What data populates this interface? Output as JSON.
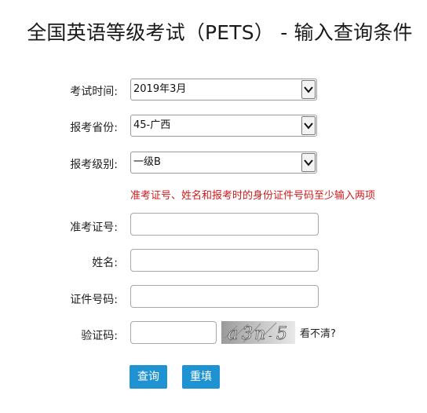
{
  "title": "全国英语等级考试（PETS） - 输入查询条件",
  "form": {
    "exam_time": {
      "label": "考试时间:",
      "value": "2019年3月"
    },
    "province": {
      "label": "报考省份:",
      "value": "45-广西"
    },
    "level": {
      "label": "报考级别:",
      "value": "一级B"
    },
    "notice": "准考证号、姓名和报考时的身份证件号码至少输入两项",
    "admission_number": {
      "label": "准考证号:",
      "value": ""
    },
    "name": {
      "label": "姓名:",
      "value": ""
    },
    "id_number": {
      "label": "证件号码:",
      "value": ""
    },
    "captcha": {
      "label": "验证码:",
      "value": "",
      "image_text": "a3n5",
      "refresh_label": "看不清?"
    }
  },
  "buttons": {
    "query": "查询",
    "reset": "重填"
  },
  "colors": {
    "button_bg": "#1f93d1",
    "notice_text": "#d11a1a"
  },
  "icons": {
    "dropdown": "chevron-down-icon"
  }
}
